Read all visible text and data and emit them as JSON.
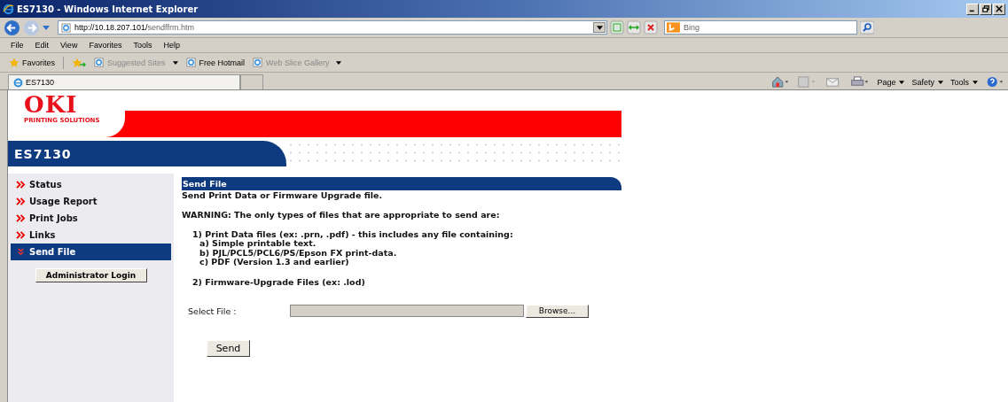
{
  "window": {
    "title": "ES7130 - Windows Internet Explorer"
  },
  "address": {
    "url_host": "http://10.18.207.101/",
    "url_path": "sendffrm.htm"
  },
  "search": {
    "placeholder": "Bing"
  },
  "menu": [
    "File",
    "Edit",
    "View",
    "Favorites",
    "Tools",
    "Help"
  ],
  "favorites_bar": {
    "label": "Favorites",
    "links": [
      {
        "label": "Suggested Sites",
        "dimmed": true,
        "dropdown": true
      },
      {
        "label": "Free Hotmail",
        "dimmed": false,
        "dropdown": false
      },
      {
        "label": "Web Slice Gallery",
        "dimmed": true,
        "dropdown": true
      }
    ]
  },
  "tabs": [
    {
      "label": "ES7130",
      "selected": true
    }
  ],
  "command_bar": [
    "Page",
    "Safety",
    "Tools"
  ],
  "page": {
    "logo": "OKI",
    "logo_tagline": "PRINTING SOLUTIONS",
    "model": "ES7130",
    "sidebar": {
      "items": [
        {
          "label": "Status",
          "selected": false
        },
        {
          "label": "Usage Report",
          "selected": false
        },
        {
          "label": "Print Jobs",
          "selected": false
        },
        {
          "label": "Links",
          "selected": false
        },
        {
          "label": "Send File",
          "selected": true
        }
      ],
      "login_button": "Administrator Login"
    },
    "section_title": "Send File",
    "intro": "Send Print Data or Firmware Upgrade file.",
    "warning": "WARNING: The only types of files that are appropriate to send are:",
    "file_types": [
      {
        "text": "1) Print Data files (ex: .prn, .pdf) - this includes any file containing:",
        "children": [
          {
            "text": "a) Simple printable text."
          },
          {
            "text": "b) PJL/PCL5/PCL6/PS/Epson FX print-data."
          },
          {
            "text": "c) PDF (Version 1.3 and earlier)"
          }
        ]
      },
      {
        "text": "2) Firmware-Upgrade Files (ex: .lod)"
      }
    ],
    "select_label": "Select File :",
    "browse_button": "Browse...",
    "send_button": "Send"
  }
}
